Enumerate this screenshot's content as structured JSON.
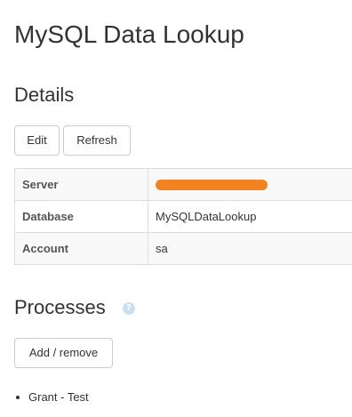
{
  "page": {
    "title": "MySQL Data Lookup"
  },
  "details": {
    "heading": "Details",
    "buttons": {
      "edit": "Edit",
      "refresh": "Refresh"
    },
    "rows": [
      {
        "label": "Server",
        "value": "",
        "redacted": true
      },
      {
        "label": "Database",
        "value": "MySQLDataLookup"
      },
      {
        "label": "Account",
        "value": "sa"
      }
    ]
  },
  "processes": {
    "heading": "Processes",
    "help_icon": "question-circle-icon",
    "add_remove_label": "Add / remove",
    "items": [
      {
        "label": "Grant - Test"
      }
    ]
  },
  "colors": {
    "redaction": "#f58220",
    "help_icon": "#c9dff0",
    "border": "#dddddd"
  }
}
